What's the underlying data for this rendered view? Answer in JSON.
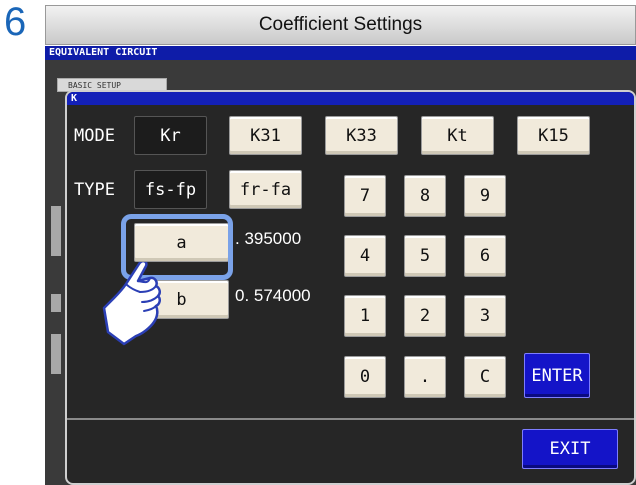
{
  "step_number": "6",
  "title": "Coefficient Settings",
  "screen": {
    "header": "EQUIVALENT CIRCUIT",
    "basic_tab": "BASIC SETUP",
    "dialog_title": "K"
  },
  "mode": {
    "label": "MODE",
    "options": [
      "Kr",
      "K31",
      "K33",
      "Kt",
      "K15"
    ],
    "selected": "Kr"
  },
  "type": {
    "label": "TYPE",
    "options": [
      "fs-fp",
      "fr-fa"
    ],
    "selected": "fs-fp"
  },
  "coefficients": {
    "a": {
      "label": "a",
      "value": "0. 395000",
      "value_display": ". 395000"
    },
    "b": {
      "label": "b",
      "value": "0. 574000"
    }
  },
  "keypad": {
    "keys": [
      "7",
      "8",
      "9",
      "4",
      "5",
      "6",
      "1",
      "2",
      "3",
      "0",
      ".",
      "C"
    ],
    "enter": "ENTER"
  },
  "exit_label": "EXIT",
  "colors": {
    "step_number": "#1a66b8",
    "header_blue": "#1320b8",
    "key_face": "#f1eadb",
    "enter_blue": "#1414c8",
    "highlight": "#7aa2e8"
  },
  "icons": [
    "pointing-hand-icon"
  ]
}
